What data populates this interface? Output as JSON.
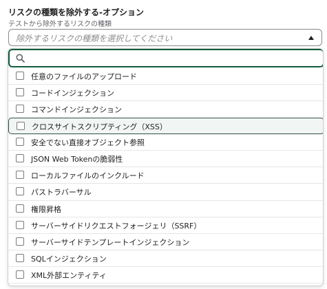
{
  "field": {
    "label": "リスクの種類を除外する-オプション",
    "description": "テストから除外するリスクの種類"
  },
  "select": {
    "placeholder": "除外するリスクの種類を選択してください",
    "caret_icon": "caret-up-icon"
  },
  "search": {
    "icon": "search-icon",
    "value": "",
    "placeholder": ""
  },
  "options": [
    {
      "label": "任意のファイルのアップロード",
      "checked": false
    },
    {
      "label": "コードインジェクション",
      "checked": false
    },
    {
      "label": "コマンドインジェクション",
      "checked": false
    },
    {
      "label": "クロスサイトスクリプティング（XSS）",
      "checked": false,
      "highlighted": true
    },
    {
      "label": "安全でない直接オブジェクト参照",
      "checked": false
    },
    {
      "label": "JSON Web Tokenの脆弱性",
      "checked": false
    },
    {
      "label": "ローカルファイルのインクルード",
      "checked": false
    },
    {
      "label": "パストラバーサル",
      "checked": false
    },
    {
      "label": "権限昇格",
      "checked": false
    },
    {
      "label": "サーバーサイドリクエストフォージェリ（SSRF）",
      "checked": false
    },
    {
      "label": "サーバーサイドテンプレートインジェクション",
      "checked": false
    },
    {
      "label": "SQLインジェクション",
      "checked": false
    },
    {
      "label": "XML外部エンティティ",
      "checked": false
    }
  ],
  "colors": {
    "focus_border": "#0f5c3b",
    "highlight_bg": "#f1f5f3"
  }
}
